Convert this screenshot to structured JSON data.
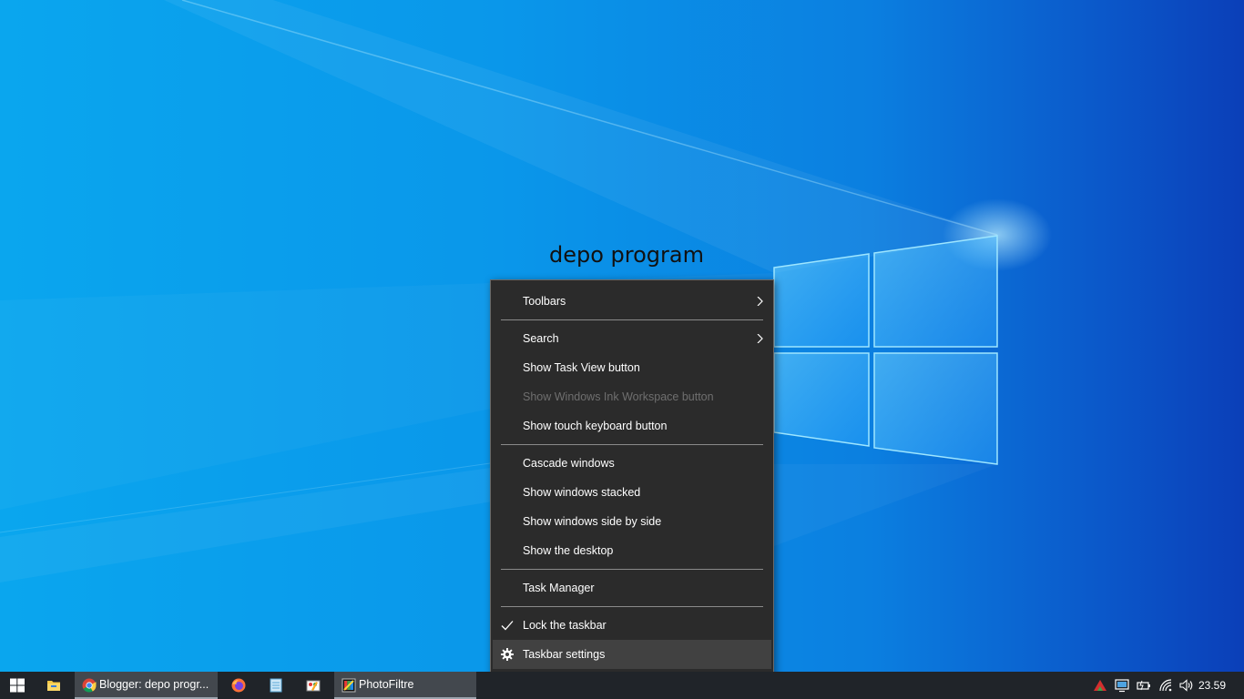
{
  "desktop": {
    "watermark_text": "depo program"
  },
  "context_menu": {
    "items": [
      {
        "label": "Toolbars",
        "submenu": true
      },
      {
        "label": "Search",
        "submenu": true
      },
      {
        "label": "Show Task View button"
      },
      {
        "label": "Show Windows Ink Workspace button",
        "disabled": true
      },
      {
        "label": "Show touch keyboard button"
      },
      {
        "label": "Cascade windows"
      },
      {
        "label": "Show windows stacked"
      },
      {
        "label": "Show windows side by side"
      },
      {
        "label": "Show the desktop"
      },
      {
        "label": "Task Manager"
      },
      {
        "label": "Lock the taskbar",
        "checked": true
      },
      {
        "label": "Taskbar settings",
        "icon": "gear-icon",
        "highlighted": true
      }
    ]
  },
  "taskbar": {
    "apps": [
      {
        "icon": "windows-start-icon"
      },
      {
        "icon": "file-explorer-icon"
      },
      {
        "icon": "chrome-icon",
        "label": "Blogger: depo progr..."
      },
      {
        "icon": "firefox-icon"
      },
      {
        "icon": "notepad-icon"
      },
      {
        "icon": "paint-icon"
      },
      {
        "icon": "photofiltre-icon",
        "label": "PhotoFiltre"
      }
    ],
    "tray_icons": [
      "red-arrow-icon",
      "display-icon",
      "battery-icon",
      "wifi-icon",
      "volume-icon"
    ],
    "clock": "23.59"
  },
  "colors": {
    "menu_bg": "#2b2b2b",
    "menu_highlight": "#414141",
    "taskbar_bg": "#202429",
    "taskbar_active": "#43484e"
  }
}
